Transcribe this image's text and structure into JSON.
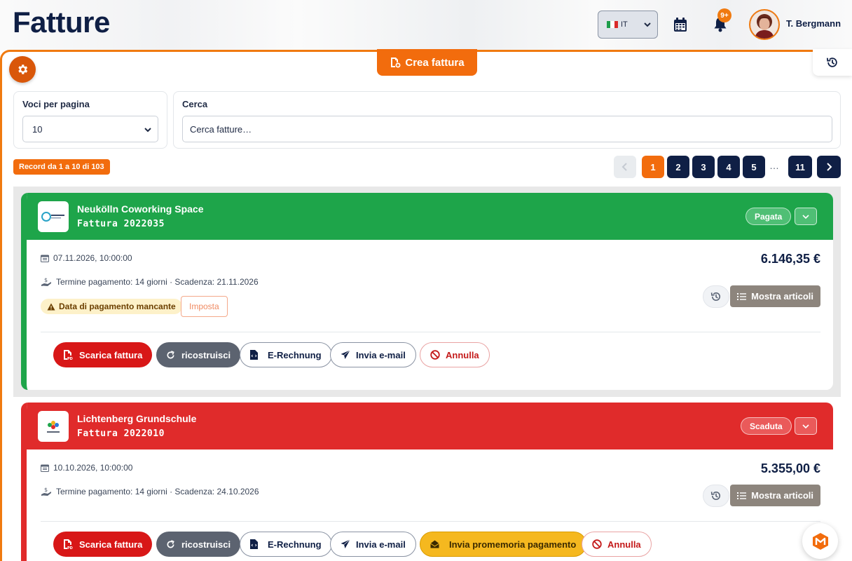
{
  "header": {
    "title": "Fatture",
    "language_code": "IT",
    "notifications_badge": "9+",
    "user_name": "T. Bergmann"
  },
  "toolbar": {
    "create_label": "Crea fattura"
  },
  "filters": {
    "per_page_label": "Voci per pagina",
    "per_page_value": "10",
    "search_label": "Cerca",
    "search_placeholder": "Cerca fatture…"
  },
  "records_text": "Record da 1 a 10 di 103",
  "pagination": {
    "pages": [
      "1",
      "2",
      "3",
      "4",
      "5"
    ],
    "ellipsis": "…",
    "last_page": "11",
    "current": "1"
  },
  "invoices": [
    {
      "client": "Neukölln Coworking Space",
      "number": "Fattura 2022035",
      "status": "Pagata",
      "date": "07.11.2026, 10:00:00",
      "terms": "Termine pagamento: 14 giorni · Scadenza: 21.11.2026",
      "amount": "6.146,35 €",
      "warning": "Data di pagamento mancante",
      "set_label": "Imposta",
      "items_label": "Mostra articoli",
      "actions": {
        "download": "Scarica fattura",
        "rebuild": "ricostruisci",
        "erechnung": "E-Rechnung",
        "email": "Invia e-mail",
        "cancel": "Annulla"
      },
      "color": "#1ea54a"
    },
    {
      "client": "Lichtenberg Grundschule",
      "number": "Fattura 2022010",
      "status": "Scaduta",
      "date": "10.10.2026, 10:00:00",
      "terms": "Termine pagamento: 14 giorni · Scadenza: 24.10.2026",
      "amount": "5.355,00 €",
      "items_label": "Mostra articoli",
      "actions": {
        "download": "Scarica fattura",
        "rebuild": "ricostruisci",
        "erechnung": "E-Rechnung",
        "email": "Invia e-mail",
        "reminder": "Invia promemoria pagamento",
        "cancel": "Annulla"
      },
      "color": "#e02b2b"
    }
  ],
  "colors": {
    "accent": "#f26c0d",
    "navy": "#0f1f45",
    "paid": "#1ea54a",
    "overdue": "#e02b2b"
  }
}
